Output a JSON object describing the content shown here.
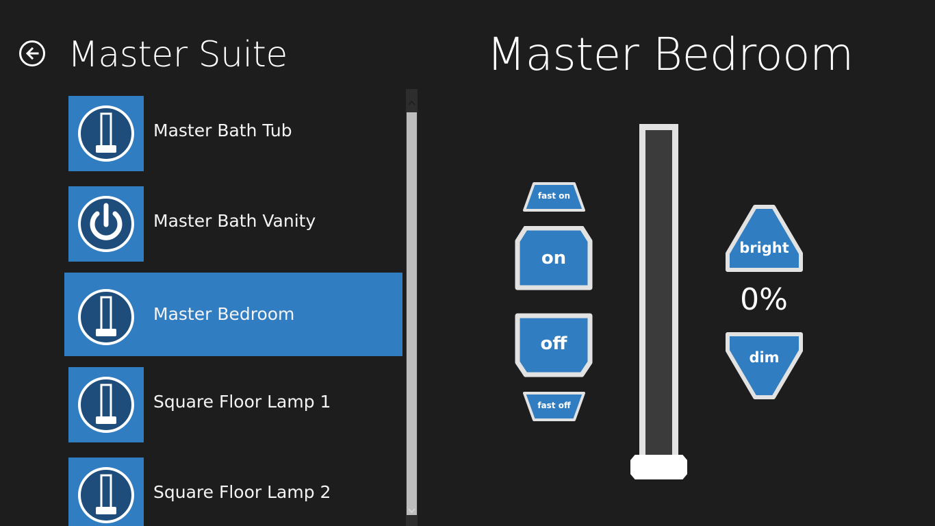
{
  "header": {
    "back_icon": "back-arrow-circle-icon",
    "section_title": "Master Suite"
  },
  "devices": [
    {
      "label": "Master Bath Tub",
      "icon": "dimmer-slider-icon",
      "selected": false
    },
    {
      "label": "Master Bath Vanity",
      "icon": "power-icon",
      "selected": false
    },
    {
      "label": "Master Bedroom",
      "icon": "dimmer-slider-icon",
      "selected": true
    },
    {
      "label": "Square Floor Lamp 1",
      "icon": "dimmer-slider-icon",
      "selected": false
    },
    {
      "label": "Square Floor Lamp 2",
      "icon": "dimmer-slider-icon",
      "selected": false
    }
  ],
  "detail": {
    "title": "Master Bedroom",
    "fast_on_label": "fast on",
    "on_label": "on",
    "off_label": "off",
    "fast_off_label": "fast off",
    "bright_label": "bright",
    "dim_label": "dim",
    "level_text": "0%",
    "level_value": 0
  },
  "colors": {
    "background": "#1d1d1d",
    "accent": "#317dc1",
    "tile_dark": "#1e4d7b",
    "button_border": "#e2e2e2",
    "slider_track": "#3b3b3b"
  }
}
